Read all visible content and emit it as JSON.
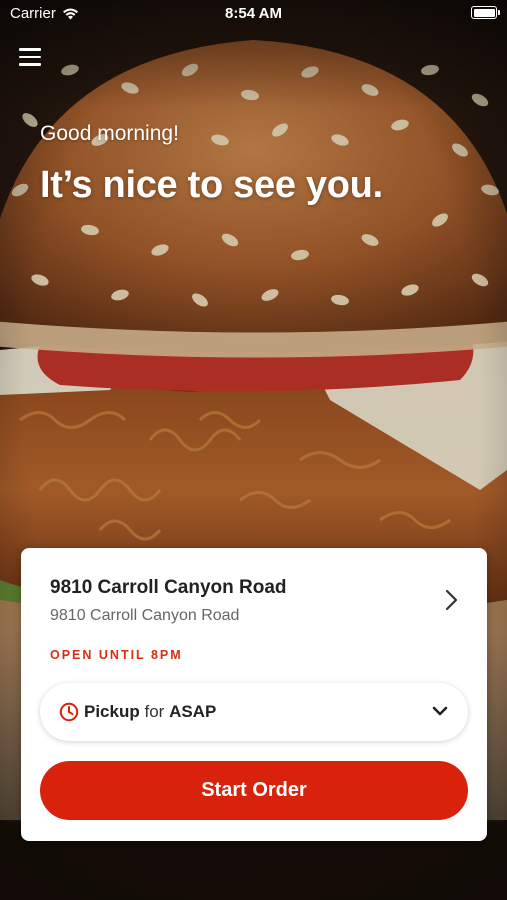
{
  "status_bar": {
    "carrier": "Carrier",
    "time": "8:54 AM",
    "icons": [
      "wifi-icon",
      "battery-icon"
    ]
  },
  "header": {
    "menu_icon": "hamburger-menu-icon"
  },
  "greeting": {
    "salutation": "Good morning!",
    "headline": "It’s nice to see you."
  },
  "store": {
    "name": "9810 Carroll Canyon Road",
    "address": "9810 Carroll Canyon Road",
    "hours": "OPEN UNTIL 8PM"
  },
  "pickup": {
    "mode": "Pickup",
    "connector": "for",
    "time": "ASAP"
  },
  "actions": {
    "start_order": "Start Order"
  },
  "colors": {
    "brand_red": "#d9220b",
    "hours_red": "#d82e12",
    "text_dark": "#222222",
    "text_muted": "#666666"
  }
}
